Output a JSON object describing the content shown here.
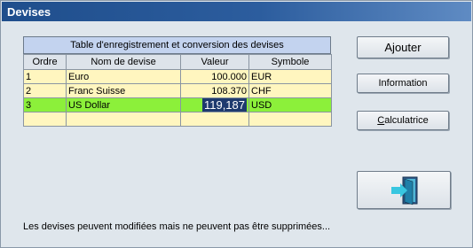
{
  "window": {
    "title": "Devises"
  },
  "table": {
    "caption": "Table d'enregistrement et conversion des devises",
    "columns": [
      "Ordre",
      "Nom de devise",
      "Valeur",
      "Symbole"
    ],
    "rows": [
      {
        "ordre": "1",
        "nom": "Euro",
        "valeur": "100.000",
        "symbole": "EUR"
      },
      {
        "ordre": "2",
        "nom": "Franc Suisse",
        "valeur": "108.370",
        "symbole": "CHF"
      },
      {
        "ordre": "3",
        "nom": "US Dollar",
        "valeur": "119,187",
        "symbole": "USD"
      }
    ]
  },
  "buttons": {
    "ajouter": "Ajouter",
    "information": "Information",
    "calculatrice_prefix": "C",
    "calculatrice_rest": "alculatrice",
    "exit_icon": "exit-door-icon"
  },
  "status": "Les devises peuvent modifiées mais ne peuvent pas être supprimées...",
  "colors": {
    "title_bar": "#1f4e8c",
    "row_bg": "#fff6bf",
    "selected_row": "#8cf03a",
    "edit_cell": "#1e3a6e"
  }
}
